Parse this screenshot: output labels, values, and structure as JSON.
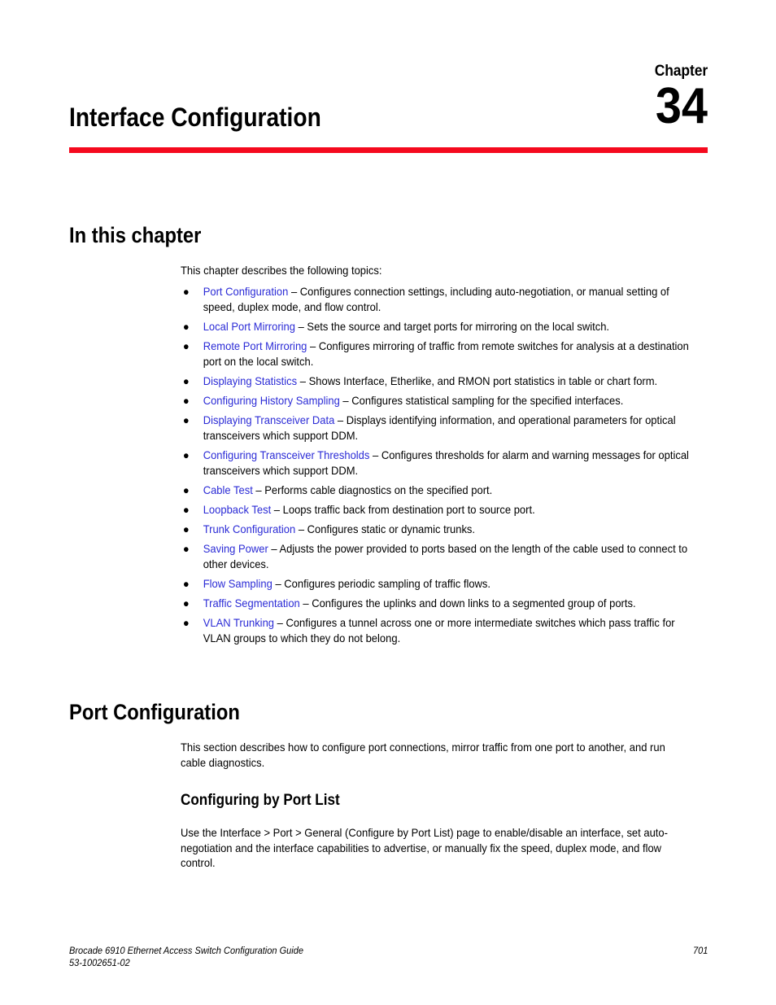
{
  "chapter": {
    "label": "Chapter",
    "number": "34",
    "title": "Interface Configuration",
    "rule_color": "#f50a1e"
  },
  "sections": {
    "in_this_chapter": {
      "heading": "In this chapter",
      "intro": "This chapter describes the following topics:"
    },
    "port_configuration": {
      "heading": "Port Configuration",
      "paragraph": "This section describes how to configure port connections, mirror traffic from one port to another, and run cable diagnostics."
    },
    "configuring_by_port_list": {
      "heading": "Configuring by Port List",
      "paragraph": "Use the Interface > Port > General (Configure by Port List) page to enable/disable an interface, set auto-negotiation and the interface capabilities to advertise, or manually fix the speed, duplex mode, and flow control."
    }
  },
  "bullet_glyph": "●",
  "separator": "–",
  "link_color": "#2b2bd6",
  "topics": [
    {
      "link": "Port Configuration",
      "description": "Configures connection settings, including auto-negotiation, or manual setting of speed, duplex mode, and flow control."
    },
    {
      "link": "Local Port Mirroring",
      "description": "Sets the source and target ports for mirroring on the local switch."
    },
    {
      "link": "Remote Port Mirroring",
      "description": "Configures mirroring of traffic from remote switches for analysis at a destination port on the local switch."
    },
    {
      "link": "Displaying Statistics",
      "description": "Shows Interface, Etherlike, and RMON port statistics in table or chart form."
    },
    {
      "link": "Configuring History Sampling",
      "description": "Configures statistical sampling for the specified interfaces."
    },
    {
      "link": "Displaying Transceiver Data",
      "description": "Displays identifying information, and operational parameters for optical transceivers which support DDM."
    },
    {
      "link": "Configuring Transceiver Thresholds",
      "description": "Configures thresholds for alarm and warning messages for optical transceivers which support DDM."
    },
    {
      "link": "Cable Test",
      "description": "Performs cable diagnostics on the specified port."
    },
    {
      "link": "Loopback Test",
      "description": "Loops traffic back from destination port to source port."
    },
    {
      "link": "Trunk Configuration",
      "description": "Configures static or dynamic trunks."
    },
    {
      "link": "Saving Power",
      "description": "Adjusts the power provided to ports based on the length of the cable used to connect to other devices."
    },
    {
      "link": "Flow Sampling",
      "description": "Configures periodic sampling of traffic flows."
    },
    {
      "link": "Traffic Segmentation",
      "description": "Configures the uplinks and down links to a segmented group of ports."
    },
    {
      "link": "VLAN Trunking",
      "description": "Configures a tunnel across one or more intermediate switches which pass traffic for VLAN groups to which they do not belong."
    }
  ],
  "footer": {
    "document_title": "Brocade 6910 Ethernet Access Switch Configuration Guide",
    "document_number": "53-1002651-02",
    "page_number": "701"
  }
}
